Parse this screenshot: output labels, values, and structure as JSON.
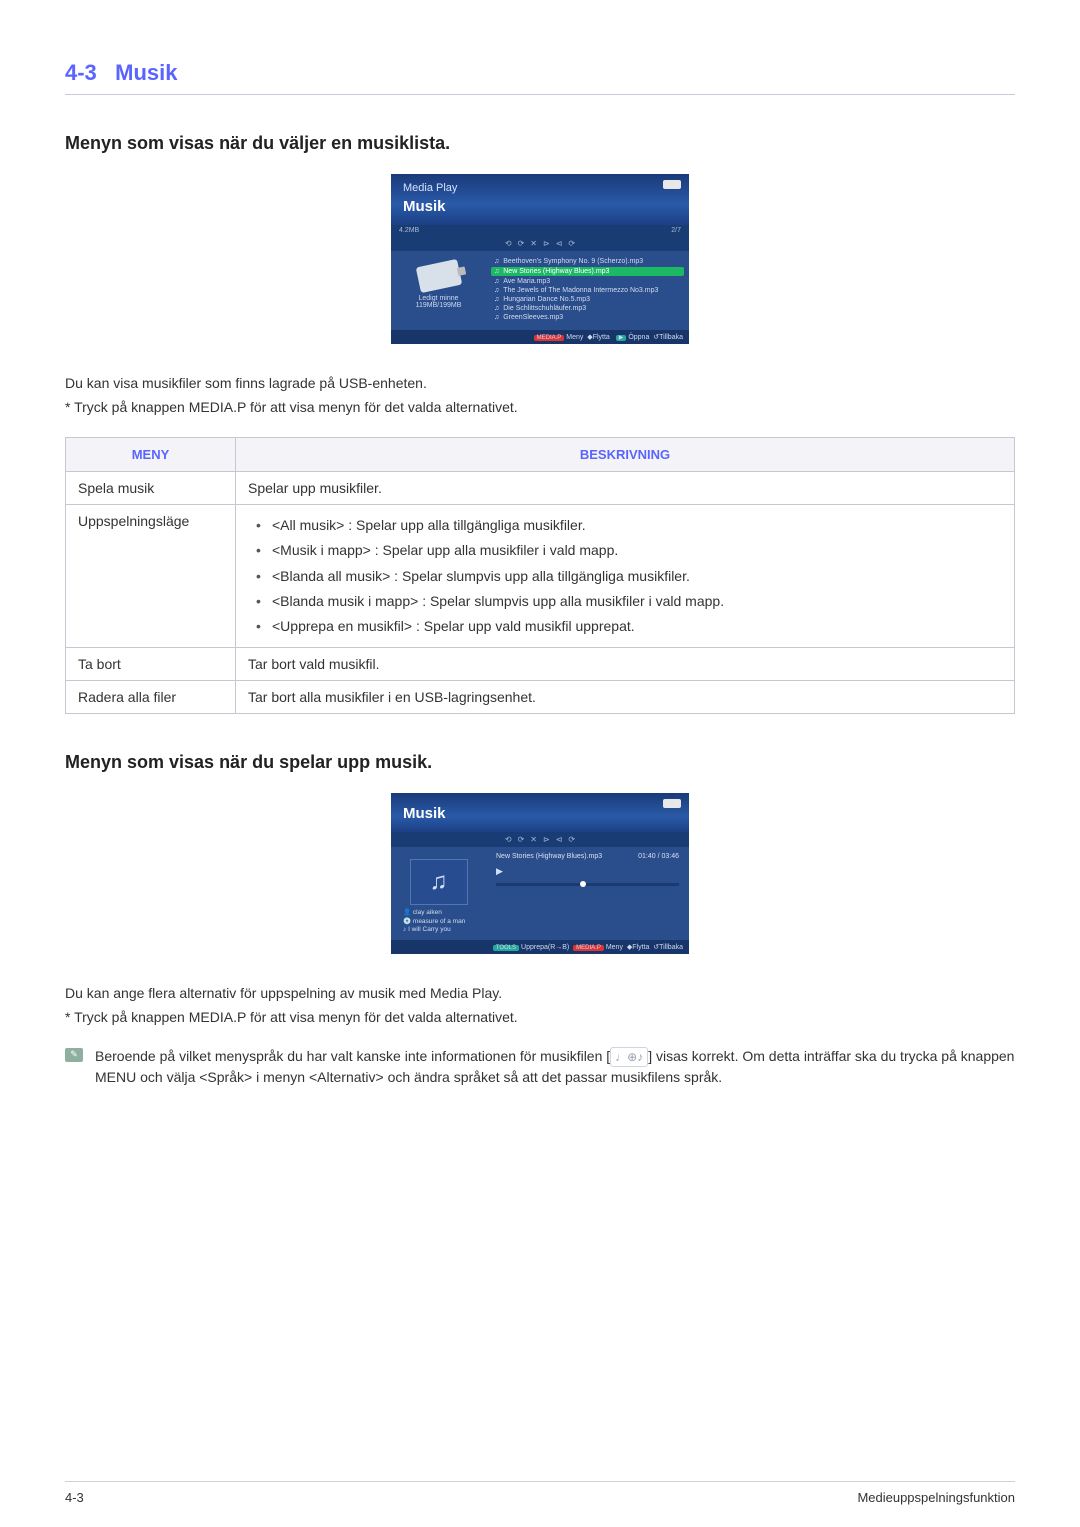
{
  "header": {
    "section": "4-3",
    "title": "Musik"
  },
  "subtitle1": "Menyn som visas när du väljer en musiklista.",
  "shot1": {
    "topTitle": "Media Play",
    "tab": "Musik",
    "size": "4.2MB",
    "count": "2/7",
    "freeLabel": "Ledigt minne",
    "freeValue": "119MB/199MB",
    "tracks": [
      "Beethoven's Symphony No. 9 (Scherzo).mp3",
      "New Stories (Highway Blues).mp3",
      "Ave Maria.mp3",
      "The Jewels of The Madonna Intermezzo No3.mp3",
      "Hungarian Dance No.5.mp3",
      "Die Schlittschuhläufer.mp3",
      "GreenSleeves.mp3"
    ],
    "selectedIndex": 1,
    "footerItems": [
      "Meny",
      "Flytta",
      "Öppna",
      "Tillbaka"
    ],
    "footerPill": "MEDIA.P"
  },
  "para1": "Du kan visa musikfiler som finns lagrade på USB-enheten.",
  "note1": "* Tryck på knappen MEDIA.P för att visa menyn för det valda alternativet.",
  "table": {
    "headers": {
      "menu": "MENY",
      "desc": "BESKRIVNING"
    },
    "rows": [
      {
        "name": "Spela musik",
        "desc": "Spelar upp musikfiler."
      },
      {
        "name": "Uppspelningsläge",
        "bullets": [
          "<All musik> : Spelar upp alla tillgängliga musikfiler.",
          "<Musik i mapp> : Spelar upp alla musikfiler i vald mapp.",
          "<Blanda all musik> : Spelar slumpvis upp alla tillgängliga musikfiler.",
          "<Blanda musik i mapp> : Spelar slumpvis upp alla musikfiler i vald mapp.",
          "<Upprepa en musikfil> : Spelar upp vald musikfil upprepat."
        ]
      },
      {
        "name": "Ta bort",
        "desc": "Tar bort vald musikfil."
      },
      {
        "name": "Radera alla filer",
        "desc": "Tar bort alla musikfiler i en USB-lagringsenhet."
      }
    ]
  },
  "subtitle2": "Menyn som visas när du spelar upp musik.",
  "shot2": {
    "tab": "Musik",
    "nowPlaying": "New Stories (Highway Blues).mp3",
    "time": "01:40 / 03:46",
    "artist": "clay aiken",
    "album": "measure of a man",
    "title": "I will Carry you",
    "footerItems": [
      "Upprepa(R→B)",
      "Meny",
      "Flytta",
      "Tillbaka"
    ],
    "pillTools": "TOOLS",
    "pillMedia": "MEDIA.P"
  },
  "para2": "Du kan ange flera alternativ för uppspelning av musik med Media Play.",
  "note2": "* Tryck på knappen MEDIA.P för att visa menyn för det valda alternativet.",
  "info": {
    "text1": "Beroende på vilket menyspråk du har valt kanske inte informationen för musikfilen [",
    "text2": "] visas korrekt. Om detta inträffar ska du trycka på knappen MENU och välja <Språk> i menyn <Alternativ> och ändra språket så att det passar musikfilens språk."
  },
  "footer": {
    "left": "4-3",
    "right": "Medieuppspelningsfunktion"
  }
}
